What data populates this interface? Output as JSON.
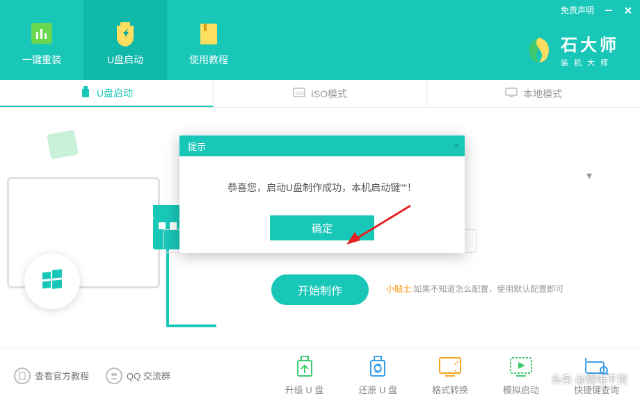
{
  "header": {
    "nav": [
      {
        "label": "一键重装"
      },
      {
        "label": "U盘启动"
      },
      {
        "label": "使用教程"
      }
    ],
    "disclaimer": "免责声明",
    "brand_title": "石大师",
    "brand_sub": "装机大师"
  },
  "mode_tabs": [
    {
      "label": "U盘启动"
    },
    {
      "label": "ISO模式"
    },
    {
      "label": "本地模式"
    }
  ],
  "start_button": "开始制作",
  "tip": {
    "label": "小贴士:",
    "text": "如果不知道怎么配置，使用默认配置即可"
  },
  "footer": {
    "links": [
      {
        "label": "查看官方教程"
      },
      {
        "label": "QQ 交流群"
      }
    ],
    "actions": [
      {
        "label": "升级 U 盘",
        "color": "#3ec96e"
      },
      {
        "label": "还原 U 盘",
        "color": "#3a9fe8"
      },
      {
        "label": "格式转换",
        "color": "#f5a623"
      },
      {
        "label": "模拟启动",
        "color": "#3ec96e"
      },
      {
        "label": "快捷键查询",
        "color": "#3a9fe8"
      }
    ]
  },
  "modal": {
    "title": "提示",
    "message": "恭喜您，启动U盘制作成功，本机启动键\"\"！",
    "ok": "确定"
  },
  "watermark": "头条 @弱电干货"
}
